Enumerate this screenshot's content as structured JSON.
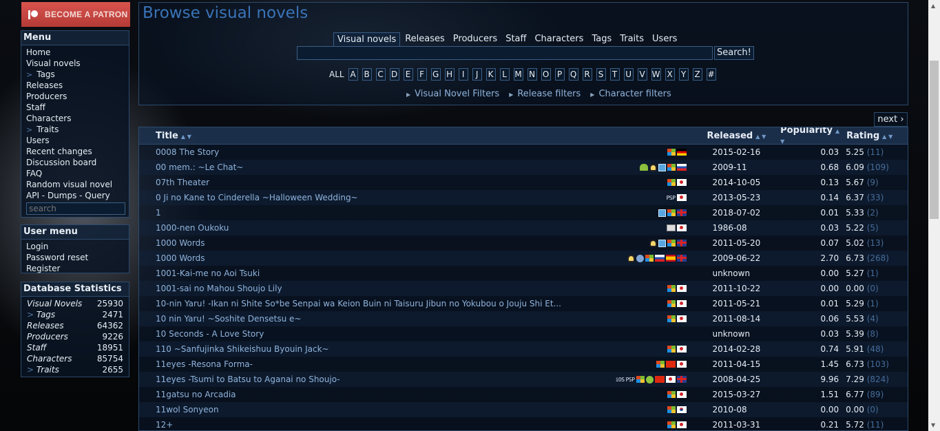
{
  "patron": {
    "label": "BECOME A PATRON"
  },
  "menu": {
    "title": "Menu",
    "items": [
      {
        "label": "Home",
        "sub": false
      },
      {
        "label": "Visual novels",
        "sub": false
      },
      {
        "label": "Tags",
        "sub": true
      },
      {
        "label": "Releases",
        "sub": false
      },
      {
        "label": "Producers",
        "sub": false
      },
      {
        "label": "Staff",
        "sub": false
      },
      {
        "label": "Characters",
        "sub": false
      },
      {
        "label": "Traits",
        "sub": true
      },
      {
        "label": "Users",
        "sub": false
      },
      {
        "label": "Recent changes",
        "sub": false
      },
      {
        "label": "Discussion board",
        "sub": false
      },
      {
        "label": "FAQ",
        "sub": false
      },
      {
        "label": "Random visual novel",
        "sub": false
      },
      {
        "label": "API - Dumps - Query",
        "sub": false
      }
    ],
    "search_placeholder": "search"
  },
  "usermenu": {
    "title": "User menu",
    "items": [
      "Login",
      "Password reset",
      "Register"
    ]
  },
  "stats": {
    "title": "Database Statistics",
    "rows": [
      {
        "label": "Visual Novels",
        "value": "25930",
        "sub": false
      },
      {
        "label": "Tags",
        "value": "2471",
        "sub": true
      },
      {
        "label": "Releases",
        "value": "64362",
        "sub": false
      },
      {
        "label": "Producers",
        "value": "9226",
        "sub": false
      },
      {
        "label": "Staff",
        "value": "18951",
        "sub": false
      },
      {
        "label": "Characters",
        "value": "85754",
        "sub": false
      },
      {
        "label": "Traits",
        "value": "2655",
        "sub": true
      }
    ]
  },
  "main": {
    "title": "Browse visual novels",
    "tabs": [
      "Visual novels",
      "Releases",
      "Producers",
      "Staff",
      "Characters",
      "Tags",
      "Traits",
      "Users"
    ],
    "active_tab": "Visual novels",
    "search_button": "Search!",
    "all_label": "ALL",
    "letters": [
      "A",
      "B",
      "C",
      "D",
      "E",
      "F",
      "G",
      "H",
      "I",
      "J",
      "K",
      "L",
      "M",
      "N",
      "O",
      "P",
      "Q",
      "R",
      "S",
      "T",
      "U",
      "V",
      "W",
      "X",
      "Y",
      "Z",
      "#"
    ],
    "filters": [
      "Visual Novel Filters",
      "Release filters",
      "Character filters"
    ],
    "next_label": "next ›"
  },
  "table": {
    "headers": {
      "title": "Title",
      "released": "Released",
      "popularity": "Popularity",
      "rating": "Rating"
    },
    "rows": [
      {
        "title": "0008 The Story",
        "icons": [
          "win",
          "de"
        ],
        "released": "2015-02-16",
        "popularity": "0.03",
        "rating": "5.25",
        "votes": "(11)"
      },
      {
        "title": "00 mem.: ~Le Chat~",
        "icons": [
          "and",
          "lin",
          "mac",
          "win",
          "ru"
        ],
        "released": "2009-11",
        "popularity": "0.68",
        "rating": "6.09",
        "votes": "(109)"
      },
      {
        "title": "07th Theater",
        "icons": [
          "win",
          "jp"
        ],
        "released": "2014-10-05",
        "popularity": "0.13",
        "rating": "5.67",
        "votes": "(9)"
      },
      {
        "title": "0 Ji no Kane to Cinderella ~Halloween Wedding~",
        "icons": [
          "psp",
          "jp"
        ],
        "released": "2013-05-23",
        "popularity": "0.14",
        "rating": "6.37",
        "votes": "(33)"
      },
      {
        "title": "1",
        "icons": [
          "mac",
          "win",
          "gb"
        ],
        "released": "2018-07-02",
        "popularity": "0.01",
        "rating": "5.33",
        "votes": "(2)"
      },
      {
        "title": "1000-nen Oukoku",
        "icons": [
          "pc98",
          "jp"
        ],
        "released": "1986-08",
        "popularity": "0.03",
        "rating": "5.22",
        "votes": "(5)"
      },
      {
        "title": "1000 Words",
        "icons": [
          "lin",
          "mac",
          "win",
          "gb"
        ],
        "released": "2011-05-20",
        "popularity": "0.07",
        "rating": "5.02",
        "votes": "(13)"
      },
      {
        "title": "1000 Words",
        "icons": [
          "lin",
          "web",
          "win",
          "ru",
          "es",
          "gb"
        ],
        "released": "2009-06-22",
        "popularity": "2.70",
        "rating": "6.73",
        "votes": "(268)"
      },
      {
        "title": "1001-Kai-me no Aoi Tsuki",
        "icons": [],
        "released": "unknown",
        "popularity": "0.00",
        "rating": "5.27",
        "votes": "(1)"
      },
      {
        "title": "1001-sai no Mahou Shoujo Lily",
        "icons": [
          "win",
          "jp"
        ],
        "released": "2011-10-22",
        "popularity": "0.00",
        "rating": "0.00",
        "votes": "(0)"
      },
      {
        "title": "10-nin Yaru! -Ikan ni Shite So*be Senpai wa Keion Buin ni Taisuru Jibun no Yokubou o Jouju Shi Et...",
        "icons": [
          "win",
          "jp"
        ],
        "released": "2011-05-21",
        "popularity": "0.01",
        "rating": "5.29",
        "votes": "(1)"
      },
      {
        "title": "10 nin Yaru! ~Soshite Densetsu e~",
        "icons": [
          "win",
          "jp"
        ],
        "released": "2011-08-14",
        "popularity": "0.06",
        "rating": "5.53",
        "votes": "(4)"
      },
      {
        "title": "10 Seconds - A Love Story",
        "icons": [],
        "released": "unknown",
        "popularity": "0.03",
        "rating": "5.39",
        "votes": "(8)"
      },
      {
        "title": "110 ~Sanfujinka Shikeishuu Byouin Jack~",
        "icons": [
          "win",
          "jp"
        ],
        "released": "2014-02-28",
        "popularity": "0.74",
        "rating": "5.91",
        "votes": "(48)"
      },
      {
        "title": "11eyes -Resona Forma-",
        "icons": [
          "win",
          "cn",
          "jp"
        ],
        "released": "2011-04-15",
        "popularity": "1.45",
        "rating": "6.73",
        "votes": "(103)"
      },
      {
        "title": "11eyes -Tsumi to Batsu to Aganai no Shoujo-",
        "icons": [
          "ios",
          "psp",
          "win",
          "xbox",
          "cn",
          "jp",
          "gb"
        ],
        "released": "2008-04-25",
        "popularity": "9.96",
        "rating": "7.29",
        "votes": "(824)"
      },
      {
        "title": "11gatsu no Arcadia",
        "icons": [
          "win",
          "jp"
        ],
        "released": "2015-03-27",
        "popularity": "1.51",
        "rating": "6.77",
        "votes": "(89)"
      },
      {
        "title": "11wol Sonyeon",
        "icons": [
          "win",
          "kr"
        ],
        "released": "2010-08",
        "popularity": "0.00",
        "rating": "0.00",
        "votes": "(0)"
      },
      {
        "title": "12+",
        "icons": [
          "win",
          "jp"
        ],
        "released": "2011-03-31",
        "popularity": "0.21",
        "rating": "5.72",
        "votes": "(11)"
      }
    ]
  }
}
